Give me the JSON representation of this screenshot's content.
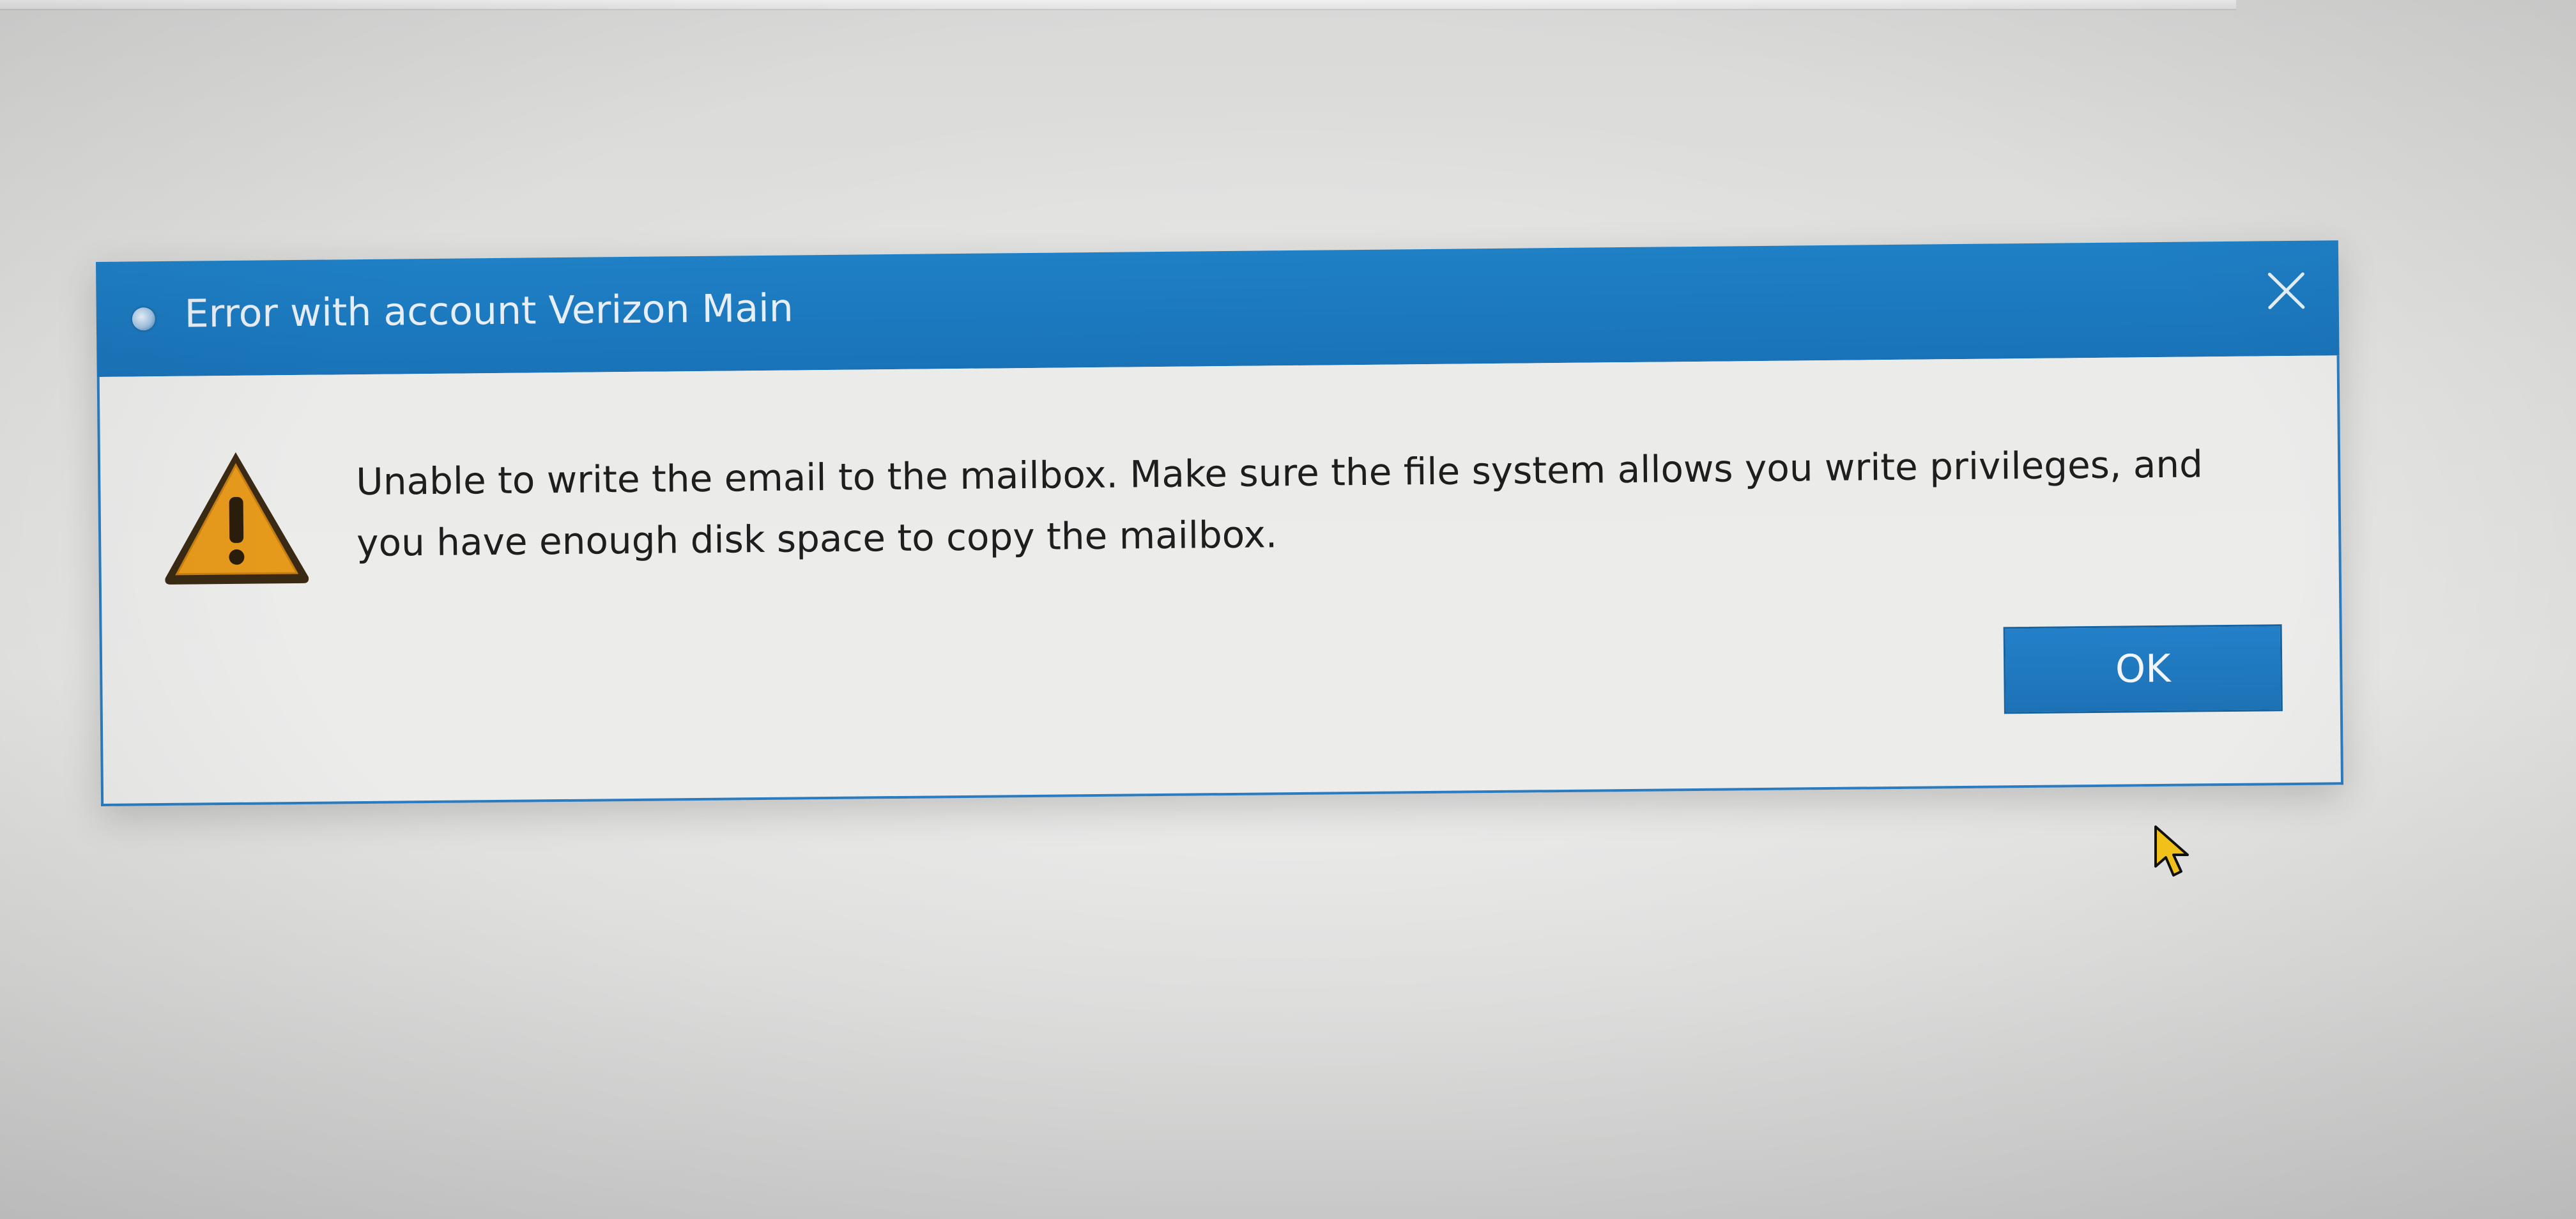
{
  "dialog": {
    "title": "Error with account Verizon Main",
    "message": "Unable to write the email to the mailbox. Make sure the file system allows you write privileges, and\nyou have enough disk space to copy the mailbox.",
    "ok_label": "OK"
  },
  "icons": {
    "app": "app-icon",
    "close": "close-icon",
    "warning": "warning-icon",
    "cursor": "mouse-cursor-icon"
  },
  "colors": {
    "titlebar": "#1f80c6",
    "button": "#2380c8",
    "warning_fill": "#e69a1c",
    "background": "#e4e4e2"
  }
}
